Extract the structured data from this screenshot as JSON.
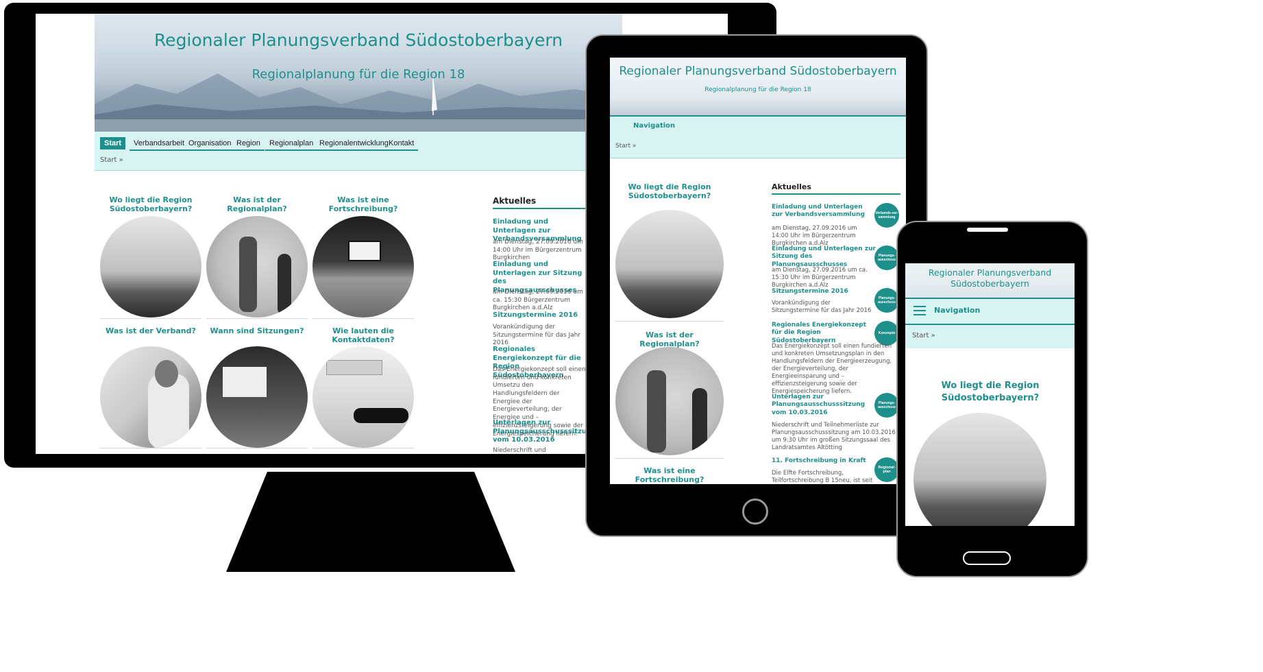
{
  "site": {
    "title": "Regionaler Planungsverband Südostoberbayern",
    "title_line1": "Regionaler Planungsverband",
    "title_line2": "Südostoberbayern",
    "subtitle": "Regionalplanung für die Region 18"
  },
  "nav": {
    "items": [
      "Start",
      "Verbandsarbeit",
      "Organisation",
      "Region",
      "Regionalplan",
      "Regionalentwicklung",
      "Kontakt"
    ],
    "mobile_label": "Navigation"
  },
  "breadcrumb": "Start »",
  "tiles": {
    "t1": "Wo liegt die Region Südostoberbayern?",
    "t2": "Was ist der Regionalplan?",
    "t3": "Was ist eine Fortschreibung?",
    "t4": "Was ist der Verband?",
    "t5": "Wann sind Sitzungen?",
    "t6": "Wie lauten die Kontaktdaten?"
  },
  "news": {
    "heading": "Aktuelles",
    "items": [
      {
        "title": "Einladung und Unterlagen zur Verbandsversammlung",
        "text": "am Dienstag, 27.09.2016 um 14:00 Uhr im Bürgerzentrum Burgkirchen a.d.Alz",
        "badge": "Verbands-ver-sammlung"
      },
      {
        "title": "Einladung und Unterlagen zur Sitzung des Planungsausschusses",
        "text": "am Dienstag, 27.09.2016 um ca. 15:30 Uhr im Bürgerzentrum Burgkirchen a.d.Alz",
        "badge": "Planungs-ausschuss"
      },
      {
        "title": "Sitzungstermine 2016",
        "text": "Vorankündigung der Sitzungstermine für das Jahr 2016",
        "badge": "Planungs-ausschuss"
      },
      {
        "title": "Regionales Energiekonzept für die Region Südostoberbayern",
        "text": "Das Energiekonzept soll einen fundierten und konkreten Umsetzungsplan in den Handlungsfeldern der Energieerzeugung, der Energieverteilung, der Energieeinsparung und –effizienzsteigerung sowie der Energiespeicherung liefern.",
        "badge": "Konzepte"
      },
      {
        "title": "Unterlagen zur Planungsausschusssitzung vom 10.03.2016",
        "text": "Niederschrift und Teilnehmerliste zur Planungsausschusssitzung am 10.03.2016 um 9:30 Uhr im großen Sitzungssaal des Landratsamtes Altötting",
        "badge": "Planungs-ausschuss"
      },
      {
        "title": "11. Fortschreibung in Kraft",
        "text": "Die Elfte Fortschreibung, Teilfortschreibung B 15neu, ist seit",
        "badge": "Regional-plan"
      }
    ]
  },
  "desktop_truncated": {
    "n1_text": "am Dienstag, 27.09.2016 um 14:00 Uhr im Bürgerzentrum Burgkirchen",
    "n2_title": "Einladung und Unterlagen zur Sitzung des Planungsausschusses",
    "n2_text": "am Dienstag, 27.09.2016 um ca. 15:30 Bürgerzentrum Burgkirchen a.d.Alz",
    "n3_text": "Vorankündigung der Sitzungstermine für das Jahr 2016",
    "n4_title": "Regionales Energiekonzept für die Region Südostoberbayern",
    "n4_text": "Das Energiekonzept soll einen fundierten und konkreten Umsetzu den Handlungsfeldern der Energiee der Energieverteilung, der Energiee und –effizienzsteigerung sowie der Energiespeicherung liefern.",
    "n5_title": "Unterlagen zur Planungsausschusssitzung vom 10.03.2016",
    "n5_text": "Niederschrift und Teilnehmerliste zu"
  },
  "colors": {
    "accent": "#1f8f8c",
    "nav_bg": "#d7f4f3",
    "device": "#000000"
  },
  "icons": [
    "hamburger-menu-icon",
    "home-button-icon"
  ]
}
